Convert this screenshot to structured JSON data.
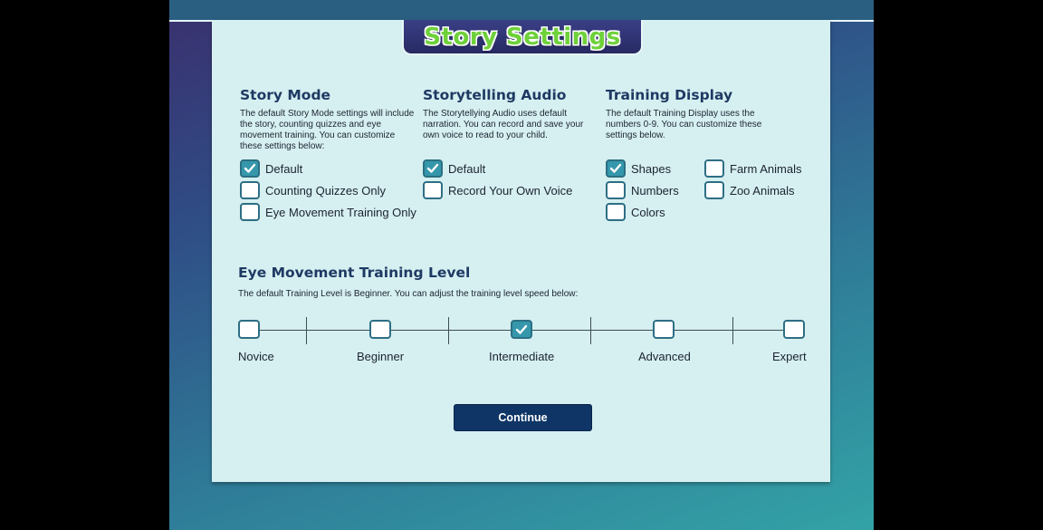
{
  "header": {
    "title": "Story Settings"
  },
  "story_mode": {
    "heading": "Story Mode",
    "description": "The default Story Mode settings will include the story, counting quizzes and eye movement training. You can customize these settings below:",
    "options": [
      {
        "label": "Default",
        "checked": true
      },
      {
        "label": "Counting Quizzes Only",
        "checked": false
      },
      {
        "label": "Eye Movement Training Only",
        "checked": false
      }
    ]
  },
  "audio": {
    "heading": "Storytelling Audio",
    "description": "The Storytellying Audio uses default narration. You can record and save your own voice to read to your child.",
    "options": [
      {
        "label": "Default",
        "checked": true
      },
      {
        "label": "Record Your Own Voice",
        "checked": false
      }
    ]
  },
  "display": {
    "heading": "Training Display",
    "description": "The default Training Display uses the numbers 0-9. You can customize these settings below.",
    "options": [
      {
        "label": "Shapes",
        "checked": true
      },
      {
        "label": "Numbers",
        "checked": false
      },
      {
        "label": "Colors",
        "checked": false
      },
      {
        "label": "Farm Animals",
        "checked": false
      },
      {
        "label": "Zoo Animals",
        "checked": false
      }
    ]
  },
  "level": {
    "heading": "Eye Movement Training Level",
    "description": "The default Training Level is Beginner. You can adjust the training level speed below:",
    "levels": [
      {
        "label": "Novice",
        "checked": false
      },
      {
        "label": "Beginner",
        "checked": false
      },
      {
        "label": "Intermediate",
        "checked": true
      },
      {
        "label": "Advanced",
        "checked": false
      },
      {
        "label": "Expert",
        "checked": false
      }
    ]
  },
  "continue_label": "Continue",
  "colors": {
    "accent": "#3597ab",
    "title_green": "#6fd13a",
    "heading": "#1e3a63",
    "button": "#0f3566"
  }
}
